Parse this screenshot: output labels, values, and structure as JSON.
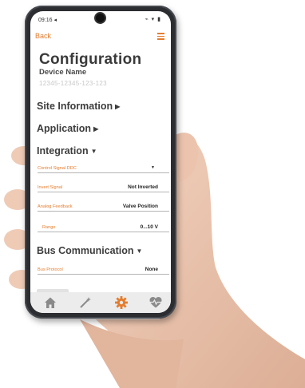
{
  "status_bar": {
    "time": "09:16 ◂",
    "icons": "⌁ ▾ ▮"
  },
  "topbar": {
    "back_label": "Back"
  },
  "header": {
    "title": "Configuration",
    "device_name_label": "Device Name",
    "device_id": "12345-12345-123-123"
  },
  "sections": {
    "site_information": "Site Information",
    "application": "Application",
    "integration": "Integration",
    "bus_communication": "Bus Communication"
  },
  "integration_rows": [
    {
      "label": "Control Signal DDC",
      "value": ""
    },
    {
      "label": "Invert Signal",
      "value": "Not Inverted"
    },
    {
      "label": "Analog Feedback",
      "value": "Valve Position"
    },
    {
      "label": "Range",
      "value": "0...10 V"
    }
  ],
  "bus_rows": [
    {
      "label": "Bus Protocol",
      "value": "None"
    }
  ],
  "tabs": [
    "home-icon",
    "wand-icon",
    "gear-icon",
    "heart-pulse-icon"
  ],
  "colors": {
    "accent": "#e47d2f",
    "text": "#3d3d3d",
    "tabbar": "#ececec"
  }
}
